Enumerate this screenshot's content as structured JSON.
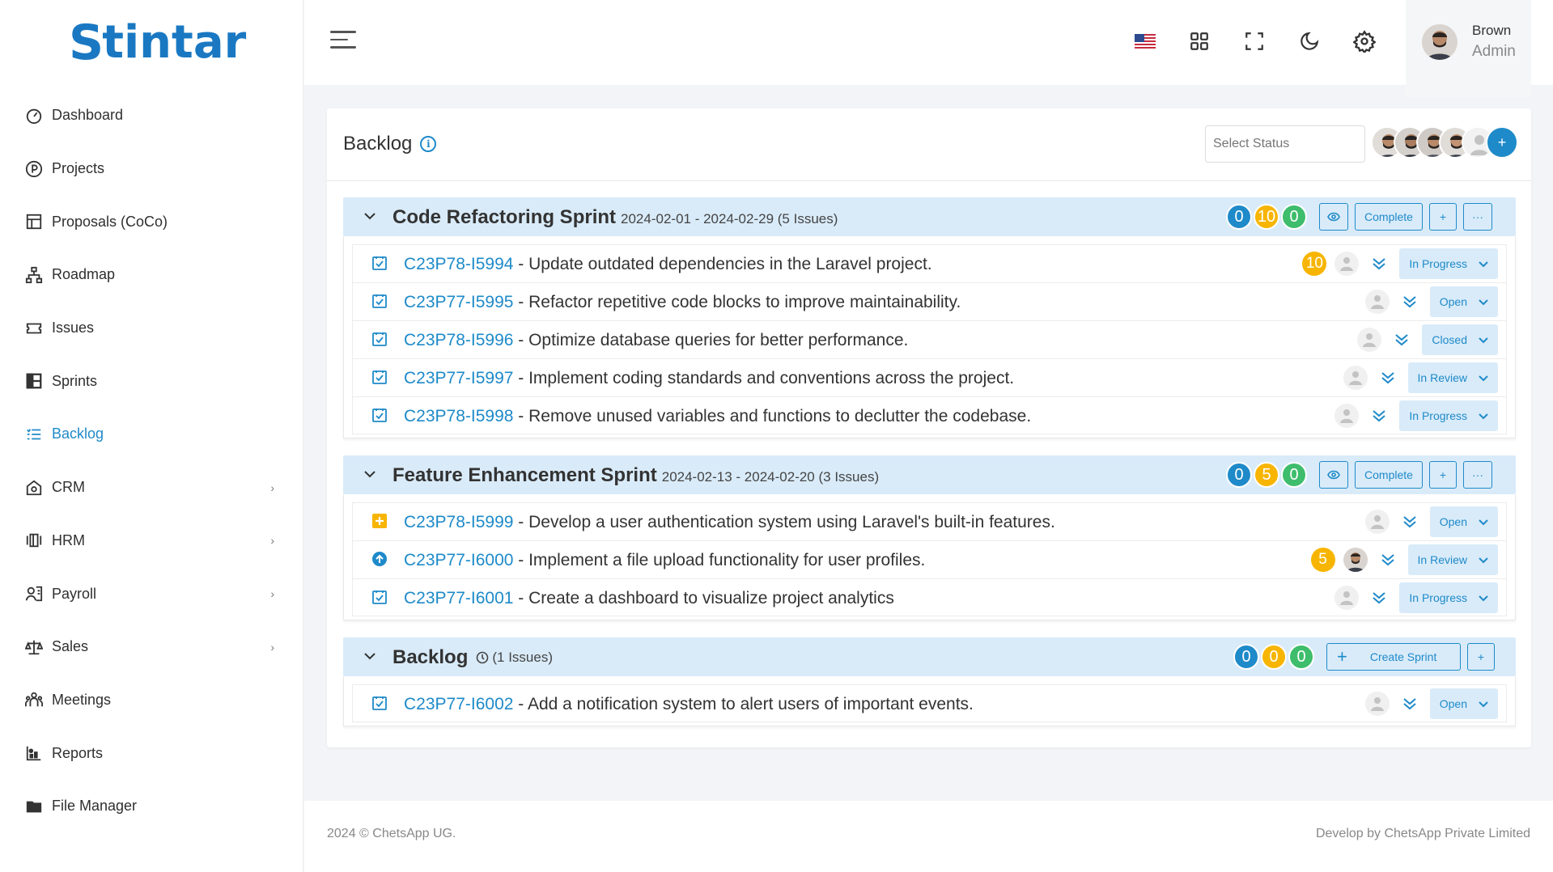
{
  "brand": {
    "logo_mark": "S",
    "logo_text": "tintar",
    "color": "#1a78c2"
  },
  "sidebar": {
    "items": [
      {
        "label": "Dashboard",
        "icon": "dashboard-icon"
      },
      {
        "label": "Projects",
        "icon": "projects-icon"
      },
      {
        "label": "Proposals (CoCo)",
        "icon": "proposals-icon"
      },
      {
        "label": "Roadmap",
        "icon": "roadmap-icon"
      },
      {
        "label": "Issues",
        "icon": "issues-icon"
      },
      {
        "label": "Sprints",
        "icon": "sprints-icon"
      },
      {
        "label": "Backlog",
        "icon": "backlog-icon",
        "active": true
      },
      {
        "label": "CRM",
        "icon": "crm-icon",
        "has_children": true
      },
      {
        "label": "HRM",
        "icon": "hrm-icon",
        "has_children": true
      },
      {
        "label": "Payroll",
        "icon": "payroll-icon",
        "has_children": true
      },
      {
        "label": "Sales",
        "icon": "sales-icon",
        "has_children": true
      },
      {
        "label": "Meetings",
        "icon": "meetings-icon"
      },
      {
        "label": "Reports",
        "icon": "reports-icon"
      },
      {
        "label": "File Manager",
        "icon": "folder-icon"
      }
    ]
  },
  "header": {
    "icons": [
      "us-flag-icon",
      "apps-grid-icon",
      "fullscreen-icon",
      "moon-icon",
      "gear-icon"
    ],
    "user": {
      "name": "Brown",
      "role": "Admin"
    }
  },
  "backlog_page": {
    "title": "Backlog",
    "status_select_placeholder": "Select Status",
    "add_member_label": "+"
  },
  "sprints": [
    {
      "name": "Code Refactoring Sprint",
      "meta": "2024-02-01 - 2024-02-29 (5 Issues)",
      "counts": [
        "0",
        "10",
        "0"
      ],
      "complete_label": "Complete",
      "plus_label": "+",
      "more_label": "···",
      "issues": [
        {
          "key": "C23P78-I5994",
          "title": " - Update outdated dependencies in the Laravel project.",
          "estimate": "10",
          "status": "In Progress",
          "type": "task"
        },
        {
          "key": "C23P77-I5995",
          "title": " - Refactor repetitive code blocks to improve maintainability.",
          "status": "Open",
          "type": "task"
        },
        {
          "key": "C23P78-I5996",
          "title": " - Optimize database queries for better performance.",
          "status": "Closed",
          "type": "task"
        },
        {
          "key": "C23P77-I5997",
          "title": " - Implement coding standards and conventions across the project.",
          "status": "In Review",
          "type": "task"
        },
        {
          "key": "C23P78-I5998",
          "title": " - Remove unused variables and functions to declutter the codebase.",
          "status": "In Progress",
          "type": "task"
        }
      ]
    },
    {
      "name": "Feature Enhancement Sprint",
      "meta": "2024-02-13 - 2024-02-20 (3 Issues)",
      "counts": [
        "0",
        "5",
        "0"
      ],
      "complete_label": "Complete",
      "plus_label": "+",
      "more_label": "···",
      "issues": [
        {
          "key": "C23P78-I5999",
          "title": " - Develop a user authentication system using Laravel's built-in features.",
          "status": "Open",
          "type": "feature"
        },
        {
          "key": "C23P77-I6000",
          "title": " - Implement a file upload functionality for user profiles.",
          "estimate": "5",
          "status": "In Review",
          "type": "improvement",
          "assignee_photo": true
        },
        {
          "key": "C23P77-I6001",
          "title": " - Create a dashboard to visualize project analytics",
          "status": "In Progress",
          "type": "task"
        }
      ]
    },
    {
      "name": "Backlog",
      "meta": "(1 Issues)",
      "counts": [
        "0",
        "0",
        "0"
      ],
      "create_sprint_label": "Create Sprint",
      "plus_label": "+",
      "issues": [
        {
          "key": "C23P77-I6002",
          "title": " - Add a notification system to alert users of important events.",
          "status": "Open",
          "type": "task"
        }
      ]
    }
  ],
  "footer": {
    "left": "2024 © ChetsApp UG.",
    "right": "Develop by ChetsApp Private Limited"
  },
  "colors": {
    "accent": "#1e8ac9",
    "sprint_header_bg": "#d9ebf9",
    "count_blue": "#1e8ac9",
    "count_yellow": "#f7b500",
    "count_green": "#3ebd6c"
  }
}
